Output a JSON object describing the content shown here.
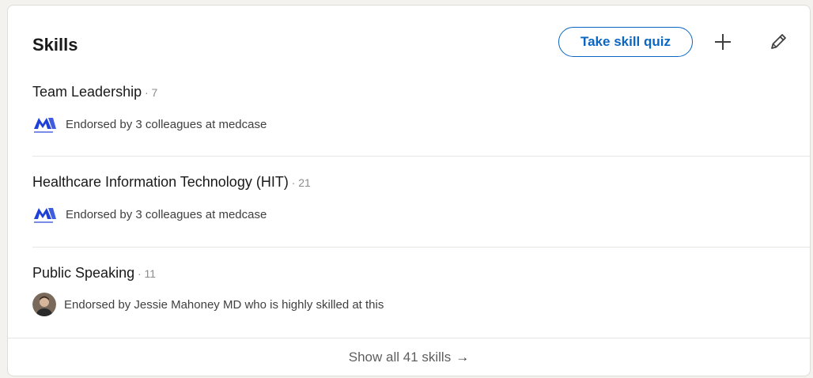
{
  "section": {
    "title": "Skills",
    "quiz_button_label": "Take skill quiz"
  },
  "skills": [
    {
      "name": "Team Leadership",
      "count": " · 7",
      "endorsement": "Endorsed by 3 colleagues at medcase",
      "endorser_type": "company-logo"
    },
    {
      "name": "Healthcare Information Technology (HIT)",
      "count": " · 21",
      "endorsement": "Endorsed by 3 colleagues at medcase",
      "endorser_type": "company-logo"
    },
    {
      "name": "Public Speaking",
      "count": " · 11",
      "endorsement": "Endorsed by Jessie Mahoney MD who is highly skilled at this",
      "endorser_type": "person-avatar"
    }
  ],
  "footer": {
    "show_all_label": "Show all 41 skills",
    "arrow": "→"
  },
  "icons": {
    "add": "plus-icon",
    "edit": "pencil-icon"
  },
  "colors": {
    "accent": "#0a66c2",
    "logo": "#1f3fd9"
  }
}
